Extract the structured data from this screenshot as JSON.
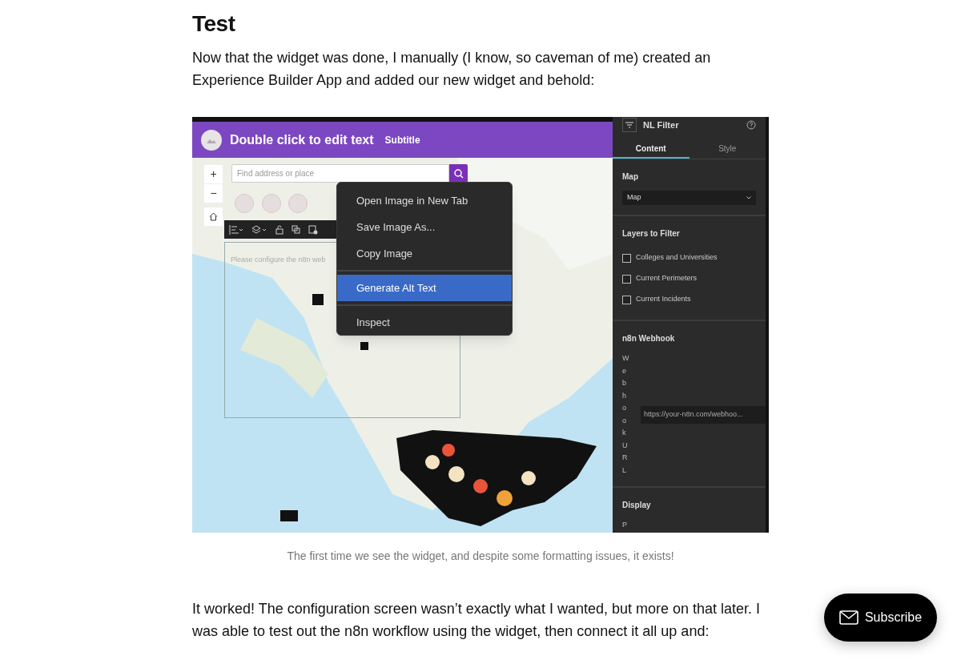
{
  "article": {
    "heading": "Test",
    "paragraph_1": "Now that the widget was done, I manually (I know, so caveman of me) created an Experience Builder App and added our new widget and behold:",
    "figure": {
      "screenshot": {
        "header": {
          "title": "Double click to edit text",
          "subtitle": "Subtitle"
        },
        "zoom_controls": [
          "+",
          "−"
        ],
        "search": {
          "placeholder": "Find address or place"
        },
        "widget_message": "Please configure the n8n web",
        "context_menu": [
          {
            "label": "Open Image in New Tab",
            "selected": false,
            "separator_before": false
          },
          {
            "label": "Save Image As...",
            "selected": false,
            "separator_before": false
          },
          {
            "label": "Copy Image",
            "selected": false,
            "separator_before": false
          },
          {
            "label": "Generate Alt Text",
            "selected": true,
            "separator_before": true
          },
          {
            "label": "Inspect",
            "selected": false,
            "separator_before": true
          }
        ],
        "panel": {
          "title": "NL Filter",
          "tabs": [
            {
              "label": "Content",
              "selected": true
            },
            {
              "label": "Style",
              "selected": false
            }
          ],
          "sections": [
            {
              "kind": "select",
              "title": "Map",
              "value": "Map"
            },
            {
              "kind": "checkboxes",
              "title": "Layers to Filter",
              "items": [
                {
                  "label": "Colleges and Universities",
                  "checked": false
                },
                {
                  "label": "Current Perimeters",
                  "checked": false
                },
                {
                  "label": "Current Incidents",
                  "checked": false
                }
              ]
            },
            {
              "kind": "webhook",
              "title": "n8n Webhook",
              "vertical_label": "WebhookURL",
              "value": "https://your-n8n.com/webhoo..."
            },
            {
              "kind": "cut",
              "title": "Display",
              "vertical_label": "P"
            }
          ]
        }
      },
      "caption": "The first time we see the widget, and despite some formatting issues, it exists!"
    },
    "paragraph_2": "It worked! The configuration screen wasn’t exactly what I wanted, but more on that later. I was able to test out the n8n workflow using the widget, then connect it all up and:"
  },
  "subscribe_button": {
    "label": "Subscribe"
  }
}
